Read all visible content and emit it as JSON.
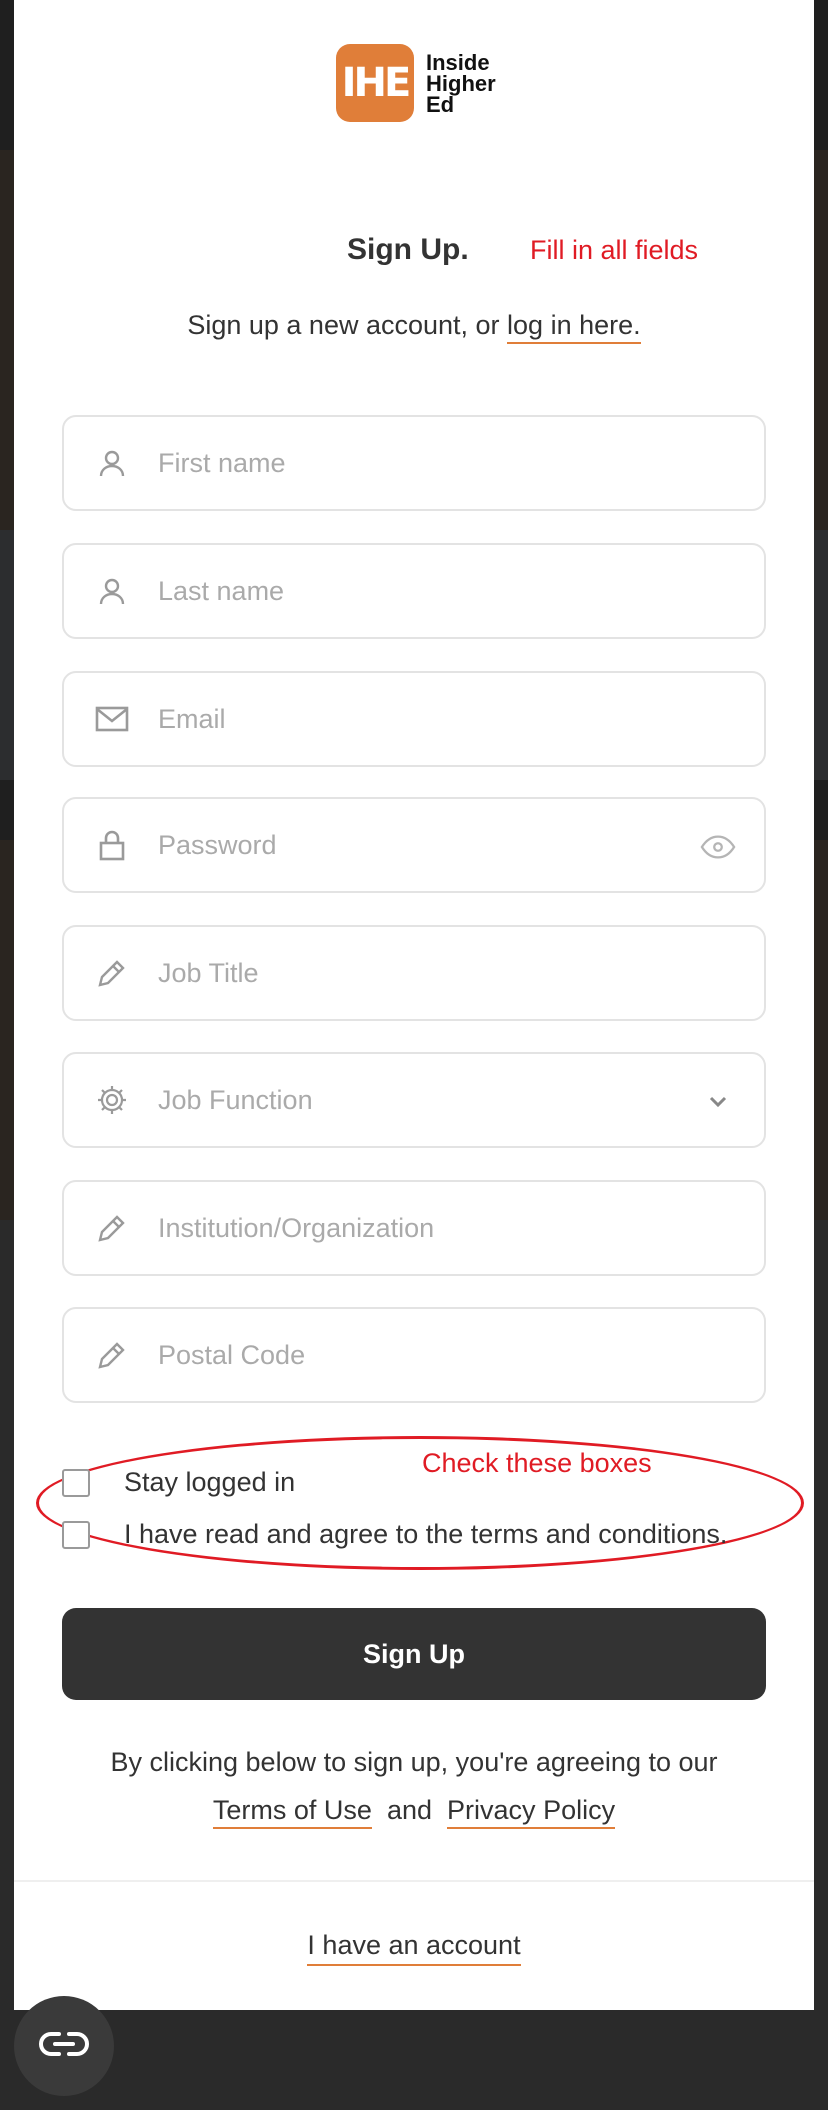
{
  "logo": {
    "mark": "IHE",
    "lines": [
      "Inside",
      "Higher",
      "Ed"
    ]
  },
  "header": {
    "title": "Sign Up.",
    "subtitle_prefix": "Sign up a new account, or ",
    "login_link": "log in here."
  },
  "annotations": {
    "fill_all": "Fill in all fields",
    "check_boxes": "Check these boxes"
  },
  "fields": {
    "first_name": {
      "placeholder": "First name",
      "icon": "user-icon"
    },
    "last_name": {
      "placeholder": "Last name",
      "icon": "user-icon"
    },
    "email": {
      "placeholder": "Email",
      "icon": "mail-icon"
    },
    "password": {
      "placeholder": "Password",
      "icon": "lock-icon",
      "toggle_icon": "eye-icon"
    },
    "job_title": {
      "placeholder": "Job Title",
      "icon": "pencil-icon"
    },
    "job_function": {
      "placeholder": "Job Function",
      "icon": "gear-icon",
      "chevron": "chevron-down-icon"
    },
    "institution": {
      "placeholder": "Institution/Organization",
      "icon": "pencil-icon"
    },
    "postal_code": {
      "placeholder": "Postal Code",
      "icon": "pencil-icon"
    }
  },
  "checkboxes": {
    "stay_logged_in": "Stay logged in",
    "agree_terms": "I have read and agree to the terms and conditions."
  },
  "signup_button": "Sign Up",
  "agreement": {
    "text": "By clicking below to sign up, you're agreeing to our",
    "terms": "Terms of Use",
    "and": "and",
    "privacy": "Privacy Policy"
  },
  "have_account": "I have an account",
  "colors": {
    "accent": "#e07e39",
    "annotation": "#e01b24",
    "button": "#333333"
  }
}
